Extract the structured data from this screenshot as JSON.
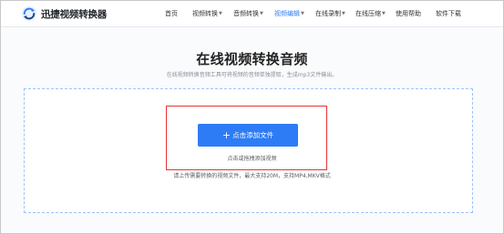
{
  "header": {
    "brand": "迅捷视频转换器",
    "nav": [
      {
        "label": "首页",
        "has_dropdown": false,
        "active": false
      },
      {
        "label": "视频转换",
        "has_dropdown": true,
        "active": false
      },
      {
        "label": "音频转换",
        "has_dropdown": true,
        "active": false
      },
      {
        "label": "视频编辑",
        "has_dropdown": true,
        "active": true
      },
      {
        "label": "在线录制",
        "has_dropdown": true,
        "active": false
      },
      {
        "label": "在线压缩",
        "has_dropdown": true,
        "active": false
      },
      {
        "label": "使用帮助",
        "has_dropdown": false,
        "active": false
      },
      {
        "label": "软件下载",
        "has_dropdown": false,
        "active": false
      }
    ]
  },
  "main": {
    "title": "在线视频转换音频",
    "subtitle": "在线视频转换音频工具可将视频的音频单独提取，生成mp3文件输出。",
    "add_file_label": "点击添加文件",
    "drag_hint": "点击或拖拽添加视频",
    "upload_note": "请上传需要转换的视频文件，最大支持20M，支持MP4,MKV格式"
  },
  "colors": {
    "accent": "#2d7cf6",
    "highlight_border": "#e33636",
    "dashed_border": "#9dc2f8"
  },
  "icons": {
    "logo": "refresh-circle-logo-icon",
    "plus": "plus-icon",
    "caret": "caret-down-icon"
  }
}
